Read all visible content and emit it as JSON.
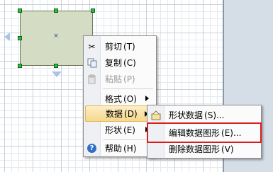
{
  "context_menu": {
    "items": [
      {
        "label": "剪切",
        "shortcut": "(T)",
        "icon": "scissors-icon"
      },
      {
        "label": "复制",
        "shortcut": "(C)",
        "icon": "copy-icon"
      },
      {
        "label": "粘贴",
        "shortcut": "(P)",
        "icon": "paste-icon",
        "disabled": true
      },
      {
        "label": "格式",
        "shortcut": "(O)",
        "submenu": true
      },
      {
        "label": "数据",
        "shortcut": "(D)",
        "submenu": true,
        "highlighted": true
      },
      {
        "label": "形状",
        "shortcut": "(E)",
        "submenu": true
      },
      {
        "label": "帮助",
        "shortcut": "(H)",
        "icon": "help-icon"
      }
    ]
  },
  "data_submenu": {
    "items": [
      {
        "label": "形状数据",
        "shortcut": "(S)...",
        "icon": "shape-data-icon"
      },
      {
        "label": "编辑数据图形",
        "shortcut": "(E)...",
        "boxed": true
      },
      {
        "label": "删除数据图形",
        "shortcut": "(V)"
      }
    ]
  },
  "colors": {
    "highlight": "#f7d98d",
    "callout_box": "#d81e1e",
    "selection_handle": "#22c33a",
    "shape_fill": "#d4dcc4"
  }
}
